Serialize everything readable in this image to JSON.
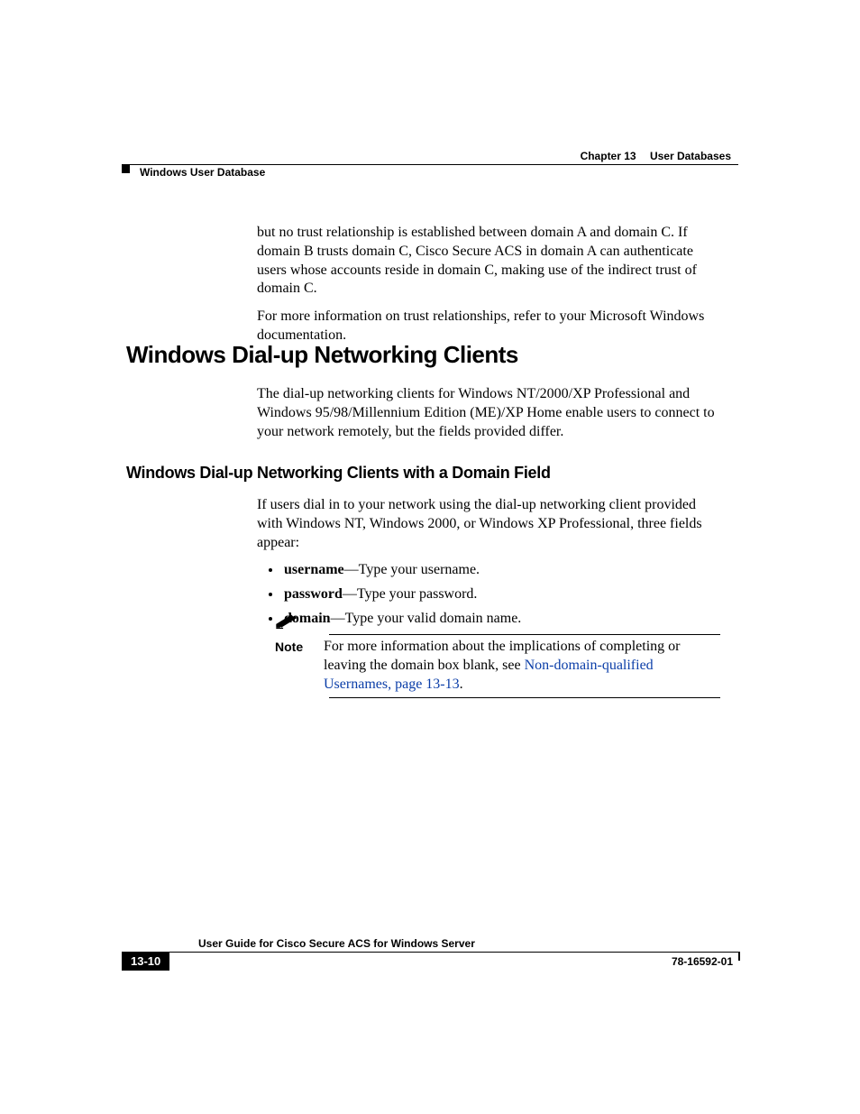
{
  "header": {
    "chapter_label": "Chapter 13",
    "chapter_title": "User Databases",
    "section_title": "Windows User Database"
  },
  "intro": {
    "p1": "but no trust relationship is established between domain A and domain C. If domain B trusts domain C, Cisco Secure ACS in domain A can authenticate users whose accounts reside in domain C, making use of the indirect trust of domain C.",
    "p2": "For more information on trust relationships, refer to your Microsoft Windows documentation."
  },
  "h1": "Windows Dial-up Networking Clients",
  "section1": {
    "p1": "The dial-up networking clients for Windows NT/2000/XP Professional and Windows 95/98/Millennium Edition (ME)/XP Home enable users to connect to your network remotely, but the fields provided differ."
  },
  "h2": "Windows Dial-up Networking Clients with a Domain Field",
  "section2": {
    "p1": "If users dial in to your network using the dial-up networking client provided with Windows NT, Windows 2000, or Windows XP Professional, three fields appear:",
    "bullets": [
      {
        "term": "username",
        "desc": "—Type your username."
      },
      {
        "term": "password",
        "desc": "—Type your password."
      },
      {
        "term": "domain",
        "desc": "—Type your valid domain name."
      }
    ]
  },
  "note": {
    "label": "Note",
    "text_before": "For more information about the implications of completing or leaving the domain box blank, see ",
    "link_text": "Non-domain-qualified Usernames, page 13-13",
    "text_after": "."
  },
  "footer": {
    "guide_title": "User Guide for Cisco Secure ACS for Windows Server",
    "page_number": "13-10",
    "doc_id": "78-16592-01"
  }
}
